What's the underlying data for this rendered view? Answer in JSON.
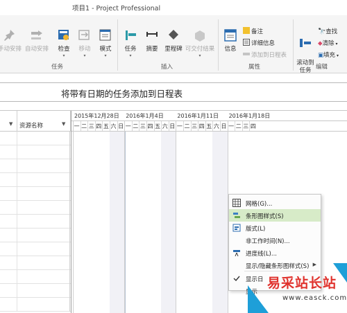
{
  "window": {
    "title": "项目1 - Project Professional"
  },
  "ribbon": {
    "cut_left": "手动安排",
    "auto_schedule": "自动安排",
    "inspect": "检查",
    "move": "移动",
    "mode": "模式",
    "task": "任务",
    "summary": "摘要",
    "milestone": "里程碑",
    "deliverable": "可交付结果",
    "info": "信息",
    "notes": "备注",
    "details": "详细信息",
    "add_to_timeline": "添加到日程表",
    "scroll_to_task": "滚动到\n任务",
    "find": "查找",
    "clear": "清除",
    "fill": "填充",
    "groups": {
      "tasks": "任务",
      "insert": "插入",
      "properties": "属性",
      "editing": "编辑"
    }
  },
  "timeline": {
    "placeholder": "将带有日期的任务添加到日程表"
  },
  "table": {
    "headers": [
      {
        "label": "资源名称"
      }
    ]
  },
  "gantt": {
    "weeks": [
      "2015年12月28日",
      "2016年1月4日",
      "2016年1月11日",
      "2016年1月18日"
    ],
    "days": [
      "一",
      "二",
      "三",
      "四",
      "五",
      "六",
      "日",
      "一",
      "二",
      "三",
      "四",
      "五",
      "六",
      "日",
      "一",
      "二",
      "三",
      "四",
      "五",
      "六",
      "日",
      "一",
      "二",
      "三",
      "四"
    ]
  },
  "context_menu": {
    "items": [
      {
        "label": "网格(G)...",
        "icon": "grid-icon"
      },
      {
        "label": "条形图样式(S)",
        "icon": "bar-style-icon",
        "highlighted": true
      },
      {
        "label": "版式(L)",
        "icon": "layout-icon"
      },
      {
        "label": "非工作时间(N)...",
        "icon": ""
      },
      {
        "label": "进度线(L)...",
        "icon": "progress-lines-icon"
      },
      {
        "label": "显示/隐藏条形图样式(S)",
        "icon": "",
        "submenu": true
      },
      {
        "label": "显示日",
        "icon": "check-icon"
      },
      {
        "label": "显示",
        "icon": ""
      }
    ]
  },
  "watermark": {
    "brand": "易采站长站",
    "url": "www.easck.com"
  },
  "colors": {
    "menu_highlight": "#d7ebc8",
    "accent_blue": "#1e9fd8",
    "brand_red": "#e0322d"
  }
}
